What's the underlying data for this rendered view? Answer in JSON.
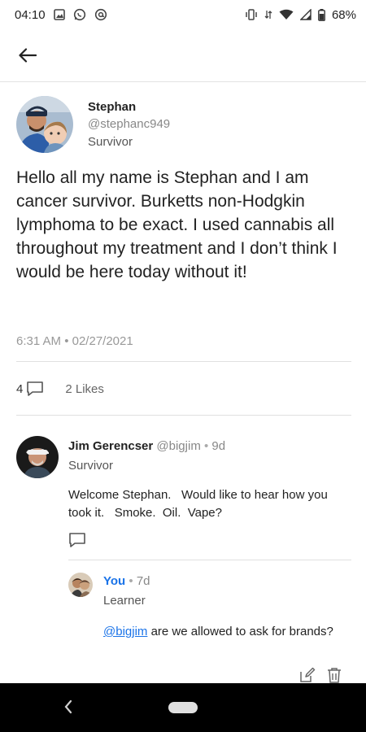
{
  "status_bar": {
    "time": "04:10",
    "battery": "68%",
    "left_icons": [
      "image-icon",
      "whatsapp-icon",
      "at-sign-icon"
    ],
    "right_icons": [
      "vibrate-icon",
      "data-icon",
      "wifi-icon",
      "signal-icon",
      "battery-icon"
    ]
  },
  "topbar": {
    "back_icon": "arrow-left-icon"
  },
  "post": {
    "author_name": "Stephan",
    "author_handle": "@stephanc949",
    "author_role": "Survivor",
    "body": "Hello all my name is Stephan and I am cancer survivor. Burketts non-Hodgkin lymphoma to be exact. I used cannabis all throughout my treatment and I don’t think I would be here today without it!",
    "timestamp": "6:31 AM • 02/27/2021",
    "comment_count": "4",
    "likes": "2 Likes"
  },
  "comment": {
    "author_name": "Jim Gerencser",
    "author_handle": "@bigjim",
    "separator": "•",
    "age": "9d",
    "role": "Survivor",
    "body": "Welcome Stephan.   Would like to hear how you took it.   Smoke.  Oil.  Vape?"
  },
  "reply": {
    "author_name": "You",
    "separator": "•",
    "age": "7d",
    "role": "Learner",
    "mention": "@bigjim",
    "body_rest": " are we allowed to ask for brands?"
  },
  "colors": {
    "accent_blue": "#1a73e8",
    "text": "#222222",
    "muted": "#888888",
    "nav_bar": "#000000"
  }
}
